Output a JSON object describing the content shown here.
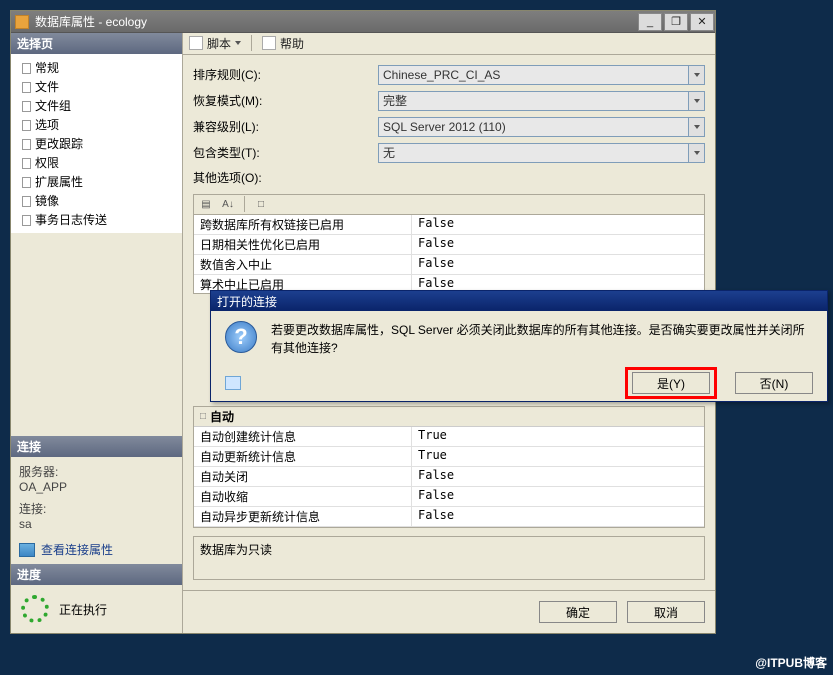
{
  "window": {
    "title": "数据库属性 - ecology",
    "minimize": "_",
    "restore": "❐",
    "close": "✕"
  },
  "sidebar": {
    "select_page_hd": "选择页",
    "items": [
      {
        "label": "常规"
      },
      {
        "label": "文件"
      },
      {
        "label": "文件组"
      },
      {
        "label": "选项"
      },
      {
        "label": "更改跟踪"
      },
      {
        "label": "权限"
      },
      {
        "label": "扩展属性"
      },
      {
        "label": "镜像"
      },
      {
        "label": "事务日志传送"
      }
    ],
    "connection_hd": "连接",
    "server_label": "服务器:",
    "server_value": "OA_APP",
    "conn_label": "连接:",
    "conn_value": "sa",
    "view_conn_props": "查看连接属性",
    "progress_hd": "进度",
    "progress_text": "正在执行"
  },
  "toolbar": {
    "script": "脚本",
    "help": "帮助"
  },
  "form": {
    "collation_label": "排序规则(C):",
    "collation_value": "Chinese_PRC_CI_AS",
    "recovery_label": "恢复模式(M):",
    "recovery_value": "完整",
    "compat_label": "兼容级别(L):",
    "compat_value": "SQL Server 2012 (110)",
    "containment_label": "包含类型(T):",
    "containment_value": "无",
    "other_label": "其他选项(O):"
  },
  "grid_top": [
    {
      "k": "跨数据库所有权链接已启用",
      "v": "False"
    },
    {
      "k": "日期相关性优化已启用",
      "v": "False"
    },
    {
      "k": "数值舍入中止",
      "v": "False"
    },
    {
      "k": "算术中止已启用",
      "v": "False"
    }
  ],
  "grid_cat": "自动",
  "grid_bottom": [
    {
      "k": "自动创建统计信息",
      "v": "True"
    },
    {
      "k": "自动更新统计信息",
      "v": "True"
    },
    {
      "k": "自动关闭",
      "v": "False"
    },
    {
      "k": "自动收缩",
      "v": "False"
    },
    {
      "k": "自动异步更新统计信息",
      "v": "False"
    }
  ],
  "desc_title": "数据库为只读",
  "buttons": {
    "ok": "确定",
    "cancel": "取消"
  },
  "dialog": {
    "title": "打开的连接",
    "message": "若要更改数据库属性，SQL Server 必须关闭此数据库的所有其他连接。是否确实要更改属性并关闭所有其他连接?",
    "yes": "是(Y)",
    "no": "否(N)"
  },
  "watermark": "@ITPUB博客"
}
